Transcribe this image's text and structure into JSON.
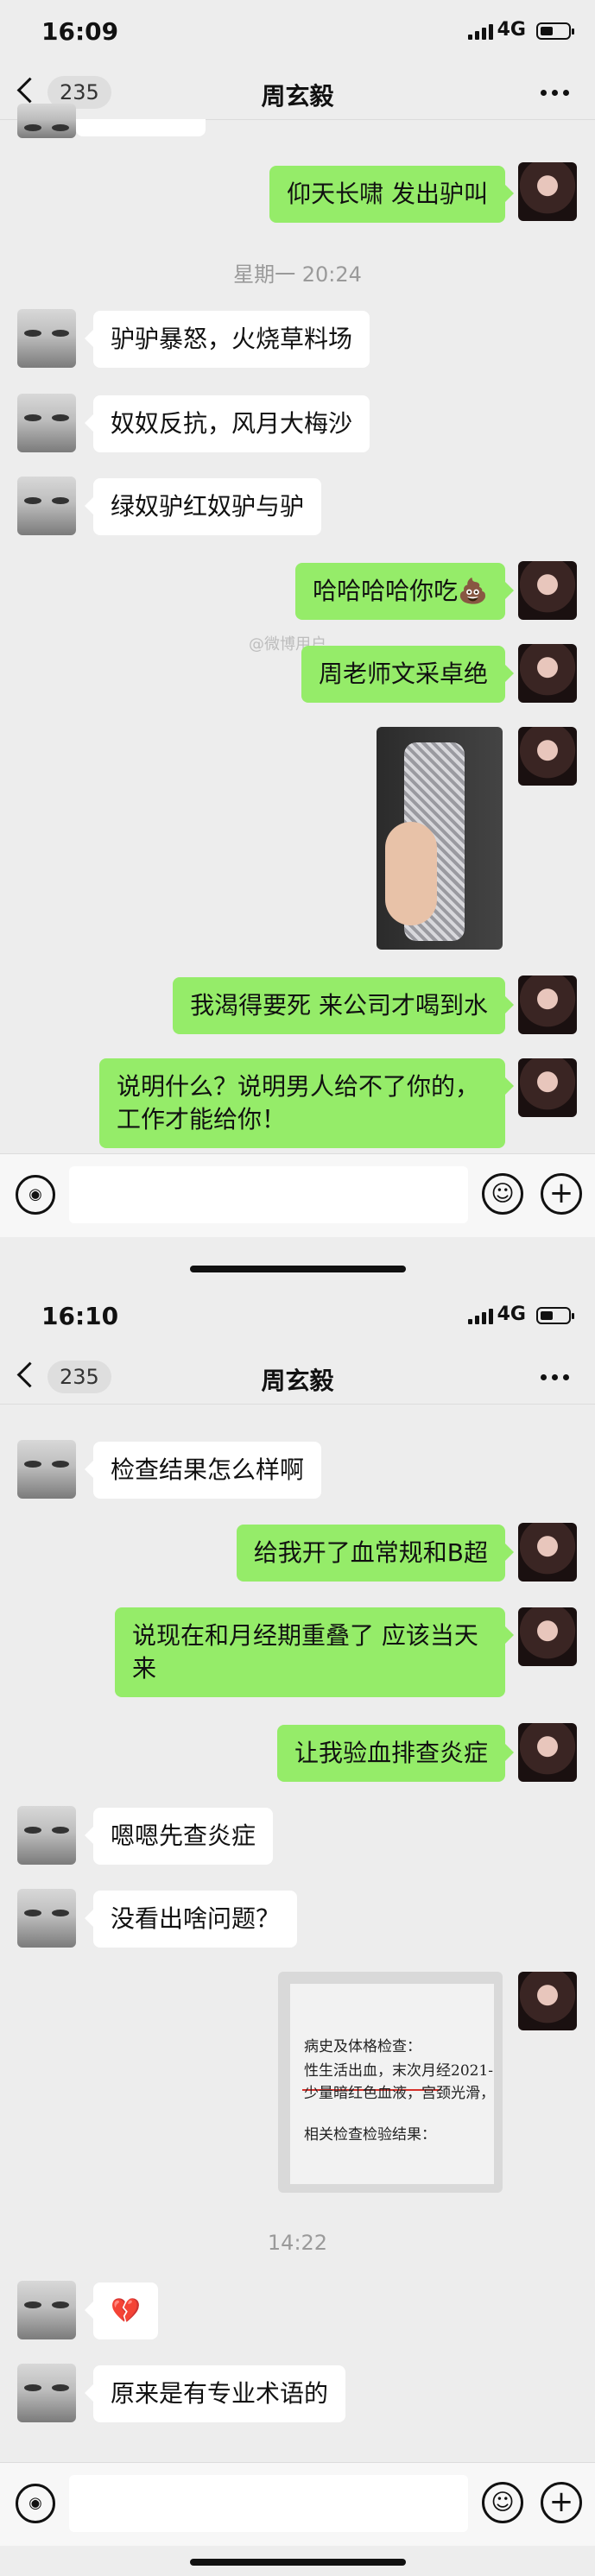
{
  "screens": [
    {
      "time": "16:09",
      "network": "4G",
      "badge": "235",
      "title": "周玄毅",
      "messages": [
        {
          "side": "out",
          "text": "仰天长啸 发出驴叫"
        },
        {
          "side": "time",
          "text": "星期一 20:24"
        },
        {
          "side": "in",
          "text": "驴驴暴怒，火烧草料场"
        },
        {
          "side": "in",
          "text": "奴奴反抗，风月大梅沙"
        },
        {
          "side": "in",
          "text": "绿奴驴红奴驴与驴"
        },
        {
          "side": "out",
          "text": "哈哈哈哈你吃💩"
        },
        {
          "side": "out",
          "text": "周老师文采卓绝"
        },
        {
          "side": "out",
          "type": "image",
          "image": "rhinestone-bottle-photo"
        },
        {
          "side": "out",
          "text": "我渴得要死 来公司才喝到水"
        },
        {
          "side": "out",
          "text": "说明什么？说明男人给不了你的，工作才能给你！"
        }
      ]
    },
    {
      "time": "16:10",
      "network": "4G",
      "badge": "235",
      "title": "周玄毅",
      "messages": [
        {
          "side": "in",
          "text": "检查结果怎么样啊"
        },
        {
          "side": "out",
          "text": "给我开了血常规和B超"
        },
        {
          "side": "out",
          "text": "说现在和月经期重叠了 应该当天来"
        },
        {
          "side": "out",
          "text": "让我验血排查炎症"
        },
        {
          "side": "in",
          "text": "嗯嗯先查炎症"
        },
        {
          "side": "in",
          "text": "没看出啥问题？"
        },
        {
          "side": "out",
          "type": "image",
          "image": "medical-record-photo",
          "doc_lines": [
            "病史及体格检查：",
            "性生活出血，末次月经2021-",
            "少量暗红色血液，宫颈光滑，",
            "相关检查检验结果："
          ]
        },
        {
          "side": "time",
          "text": "14:22"
        },
        {
          "side": "in",
          "text": "💔"
        },
        {
          "side": "in",
          "text": "原来是有专业术语的"
        }
      ]
    }
  ],
  "watermark": "@微博用户",
  "icons": {
    "voice": "voice-icon",
    "emoji": "emoji-icon",
    "plus": "plus-icon",
    "voice_glyph": "◉",
    "emoji_glyph": "☺",
    "plus_glyph": "+"
  }
}
